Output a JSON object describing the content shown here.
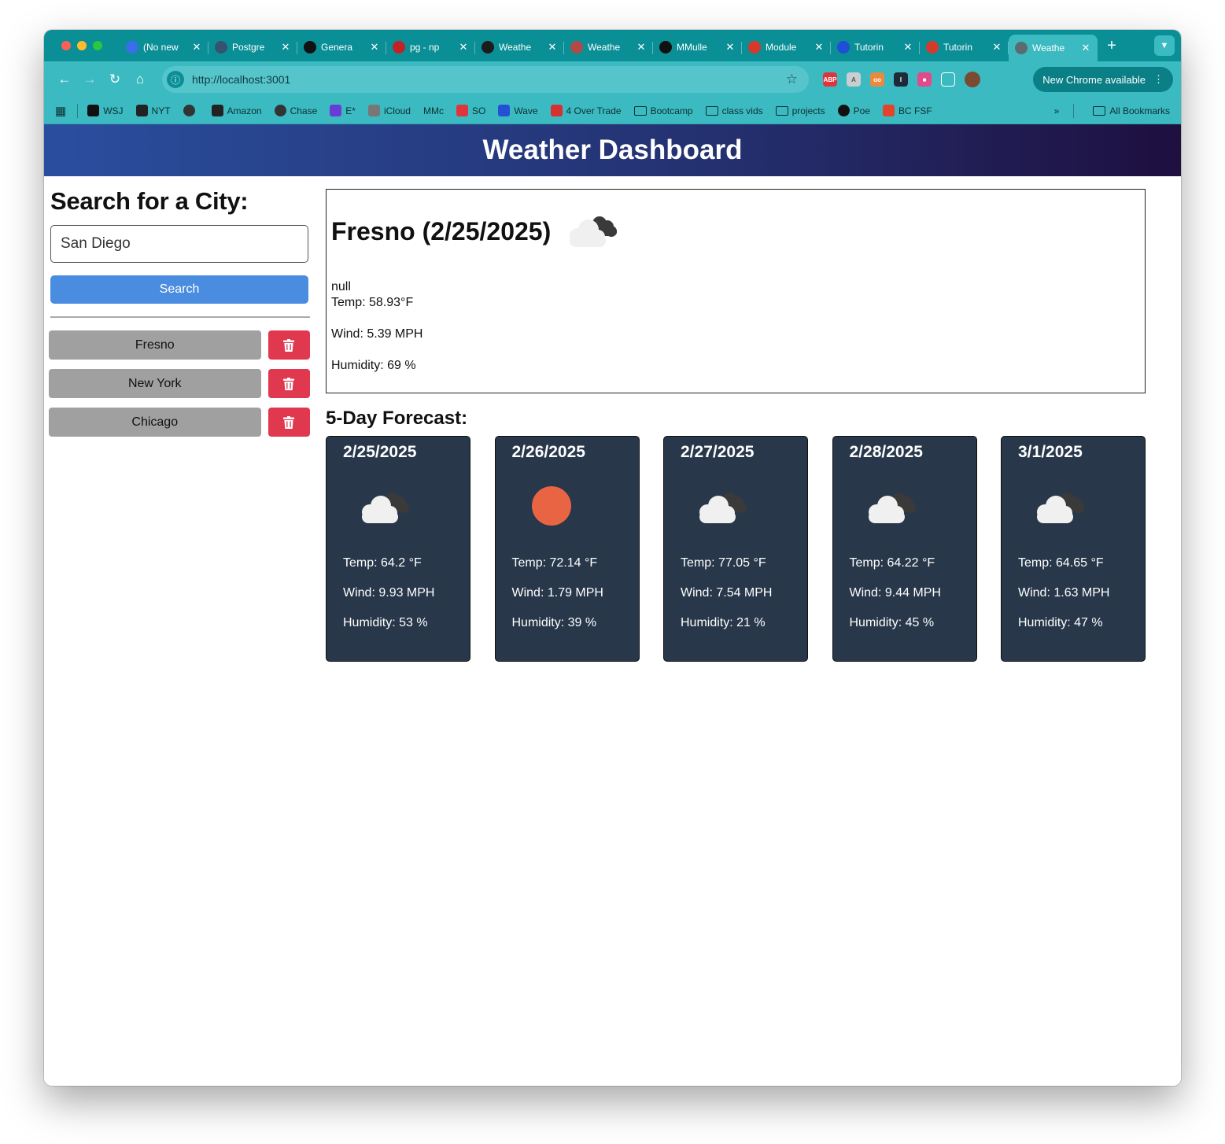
{
  "browser": {
    "tabs": [
      {
        "title": "(No new",
        "favicon": "mail-icon",
        "color": "#3b6ee8"
      },
      {
        "title": "Postgre",
        "favicon": "postgres-icon",
        "color": "#35536e"
      },
      {
        "title": "Genera",
        "favicon": "github-icon",
        "color": "#111111"
      },
      {
        "title": "pg - np",
        "favicon": "npm-icon",
        "color": "#c12127"
      },
      {
        "title": "Weathe",
        "favicon": "check-icon",
        "color": "#1c1c1c"
      },
      {
        "title": "Weathe",
        "favicon": "weather-icon",
        "color": "#b34a48"
      },
      {
        "title": "MMulle",
        "favicon": "github-icon",
        "color": "#111111"
      },
      {
        "title": "Module",
        "favicon": "canvas-icon",
        "color": "#d6392b"
      },
      {
        "title": "Tutorin",
        "favicon": "zoom-icon",
        "color": "#1f4fd6"
      },
      {
        "title": "Tutorin",
        "favicon": "canvas-icon",
        "color": "#d6392b"
      },
      {
        "title": "Weathe",
        "favicon": "globe-icon",
        "color": "#5c6b70",
        "active": true
      }
    ],
    "url": "http://localhost:3001",
    "update_label": "New Chrome available",
    "bookmarks": [
      {
        "label": "WSJ",
        "icon": "wsj-icon"
      },
      {
        "label": "NYT",
        "icon": "nyt-icon"
      },
      {
        "label": "",
        "icon": "globe-icon"
      },
      {
        "label": "Amazon",
        "icon": "amazon-icon"
      },
      {
        "label": "Chase",
        "icon": "globe-icon"
      },
      {
        "label": "E*",
        "icon": "etrade-icon"
      },
      {
        "label": "iCloud",
        "icon": "apple-icon"
      },
      {
        "label": "MMc",
        "icon": "none"
      },
      {
        "label": "SO",
        "icon": "stackoverflow-icon"
      },
      {
        "label": "Wave",
        "icon": "wave-icon"
      },
      {
        "label": "4 Over Trade",
        "icon": "4over-icon"
      },
      {
        "label": "Bootcamp",
        "icon": "folder-icon"
      },
      {
        "label": "class vids",
        "icon": "folder-icon"
      },
      {
        "label": "projects",
        "icon": "folder-icon"
      },
      {
        "label": "Poe",
        "icon": "poe-icon"
      },
      {
        "label": "BC FSF",
        "icon": "gitlab-icon"
      }
    ],
    "all_bookmarks_label": "All Bookmarks"
  },
  "app": {
    "title": "Weather Dashboard",
    "search_heading": "Search for a City:",
    "search_value": "San Diego",
    "search_button": "Search",
    "history": [
      "Fresno",
      "New York",
      "Chicago"
    ]
  },
  "today": {
    "heading": "Fresno (2/25/2025)",
    "icon": "cloudy-icon",
    "description": "null",
    "temp": "Temp: 58.93°F",
    "wind": "Wind: 5.39 MPH",
    "humidity": "Humidity: 69 %"
  },
  "forecast_title": "5-Day Forecast:",
  "forecast": [
    {
      "date": "2/25/2025",
      "icon": "cloudy-icon",
      "temp": "Temp: 64.2 °F",
      "wind": "Wind: 9.93 MPH",
      "humidity": "Humidity: 53 %"
    },
    {
      "date": "2/26/2025",
      "icon": "sun-icon",
      "temp": "Temp: 72.14 °F",
      "wind": "Wind: 1.79 MPH",
      "humidity": "Humidity: 39 %"
    },
    {
      "date": "2/27/2025",
      "icon": "cloudy-icon",
      "temp": "Temp: 77.05 °F",
      "wind": "Wind: 7.54 MPH",
      "humidity": "Humidity: 21 %"
    },
    {
      "date": "2/28/2025",
      "icon": "cloudy-icon",
      "temp": "Temp: 64.22 °F",
      "wind": "Wind: 9.44 MPH",
      "humidity": "Humidity: 45 %"
    },
    {
      "date": "3/1/2025",
      "icon": "cloudy-icon",
      "temp": "Temp: 64.65 °F",
      "wind": "Wind: 1.63 MPH",
      "humidity": "Humidity: 47 %"
    }
  ],
  "colors": {
    "header_start": "#2a4e9e",
    "header_end": "#1e0f3f",
    "search_btn": "#4a8de0",
    "delete_btn": "#e0394f",
    "card_bg": "#28374a",
    "sun": "#e96443"
  }
}
